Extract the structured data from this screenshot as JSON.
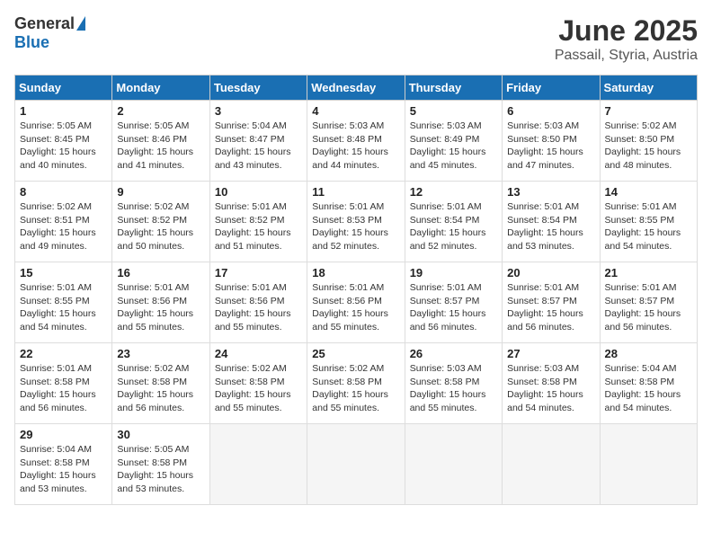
{
  "header": {
    "logo_general": "General",
    "logo_blue": "Blue",
    "title": "June 2025",
    "location": "Passail, Styria, Austria"
  },
  "columns": [
    "Sunday",
    "Monday",
    "Tuesday",
    "Wednesday",
    "Thursday",
    "Friday",
    "Saturday"
  ],
  "weeks": [
    [
      {
        "day": "1",
        "sunrise": "Sunrise: 5:05 AM",
        "sunset": "Sunset: 8:45 PM",
        "daylight": "Daylight: 15 hours and 40 minutes."
      },
      {
        "day": "2",
        "sunrise": "Sunrise: 5:05 AM",
        "sunset": "Sunset: 8:46 PM",
        "daylight": "Daylight: 15 hours and 41 minutes."
      },
      {
        "day": "3",
        "sunrise": "Sunrise: 5:04 AM",
        "sunset": "Sunset: 8:47 PM",
        "daylight": "Daylight: 15 hours and 43 minutes."
      },
      {
        "day": "4",
        "sunrise": "Sunrise: 5:03 AM",
        "sunset": "Sunset: 8:48 PM",
        "daylight": "Daylight: 15 hours and 44 minutes."
      },
      {
        "day": "5",
        "sunrise": "Sunrise: 5:03 AM",
        "sunset": "Sunset: 8:49 PM",
        "daylight": "Daylight: 15 hours and 45 minutes."
      },
      {
        "day": "6",
        "sunrise": "Sunrise: 5:03 AM",
        "sunset": "Sunset: 8:50 PM",
        "daylight": "Daylight: 15 hours and 47 minutes."
      },
      {
        "day": "7",
        "sunrise": "Sunrise: 5:02 AM",
        "sunset": "Sunset: 8:50 PM",
        "daylight": "Daylight: 15 hours and 48 minutes."
      }
    ],
    [
      {
        "day": "8",
        "sunrise": "Sunrise: 5:02 AM",
        "sunset": "Sunset: 8:51 PM",
        "daylight": "Daylight: 15 hours and 49 minutes."
      },
      {
        "day": "9",
        "sunrise": "Sunrise: 5:02 AM",
        "sunset": "Sunset: 8:52 PM",
        "daylight": "Daylight: 15 hours and 50 minutes."
      },
      {
        "day": "10",
        "sunrise": "Sunrise: 5:01 AM",
        "sunset": "Sunset: 8:52 PM",
        "daylight": "Daylight: 15 hours and 51 minutes."
      },
      {
        "day": "11",
        "sunrise": "Sunrise: 5:01 AM",
        "sunset": "Sunset: 8:53 PM",
        "daylight": "Daylight: 15 hours and 52 minutes."
      },
      {
        "day": "12",
        "sunrise": "Sunrise: 5:01 AM",
        "sunset": "Sunset: 8:54 PM",
        "daylight": "Daylight: 15 hours and 52 minutes."
      },
      {
        "day": "13",
        "sunrise": "Sunrise: 5:01 AM",
        "sunset": "Sunset: 8:54 PM",
        "daylight": "Daylight: 15 hours and 53 minutes."
      },
      {
        "day": "14",
        "sunrise": "Sunrise: 5:01 AM",
        "sunset": "Sunset: 8:55 PM",
        "daylight": "Daylight: 15 hours and 54 minutes."
      }
    ],
    [
      {
        "day": "15",
        "sunrise": "Sunrise: 5:01 AM",
        "sunset": "Sunset: 8:55 PM",
        "daylight": "Daylight: 15 hours and 54 minutes."
      },
      {
        "day": "16",
        "sunrise": "Sunrise: 5:01 AM",
        "sunset": "Sunset: 8:56 PM",
        "daylight": "Daylight: 15 hours and 55 minutes."
      },
      {
        "day": "17",
        "sunrise": "Sunrise: 5:01 AM",
        "sunset": "Sunset: 8:56 PM",
        "daylight": "Daylight: 15 hours and 55 minutes."
      },
      {
        "day": "18",
        "sunrise": "Sunrise: 5:01 AM",
        "sunset": "Sunset: 8:56 PM",
        "daylight": "Daylight: 15 hours and 55 minutes."
      },
      {
        "day": "19",
        "sunrise": "Sunrise: 5:01 AM",
        "sunset": "Sunset: 8:57 PM",
        "daylight": "Daylight: 15 hours and 56 minutes."
      },
      {
        "day": "20",
        "sunrise": "Sunrise: 5:01 AM",
        "sunset": "Sunset: 8:57 PM",
        "daylight": "Daylight: 15 hours and 56 minutes."
      },
      {
        "day": "21",
        "sunrise": "Sunrise: 5:01 AM",
        "sunset": "Sunset: 8:57 PM",
        "daylight": "Daylight: 15 hours and 56 minutes."
      }
    ],
    [
      {
        "day": "22",
        "sunrise": "Sunrise: 5:01 AM",
        "sunset": "Sunset: 8:58 PM",
        "daylight": "Daylight: 15 hours and 56 minutes."
      },
      {
        "day": "23",
        "sunrise": "Sunrise: 5:02 AM",
        "sunset": "Sunset: 8:58 PM",
        "daylight": "Daylight: 15 hours and 56 minutes."
      },
      {
        "day": "24",
        "sunrise": "Sunrise: 5:02 AM",
        "sunset": "Sunset: 8:58 PM",
        "daylight": "Daylight: 15 hours and 55 minutes."
      },
      {
        "day": "25",
        "sunrise": "Sunrise: 5:02 AM",
        "sunset": "Sunset: 8:58 PM",
        "daylight": "Daylight: 15 hours and 55 minutes."
      },
      {
        "day": "26",
        "sunrise": "Sunrise: 5:03 AM",
        "sunset": "Sunset: 8:58 PM",
        "daylight": "Daylight: 15 hours and 55 minutes."
      },
      {
        "day": "27",
        "sunrise": "Sunrise: 5:03 AM",
        "sunset": "Sunset: 8:58 PM",
        "daylight": "Daylight: 15 hours and 54 minutes."
      },
      {
        "day": "28",
        "sunrise": "Sunrise: 5:04 AM",
        "sunset": "Sunset: 8:58 PM",
        "daylight": "Daylight: 15 hours and 54 minutes."
      }
    ],
    [
      {
        "day": "29",
        "sunrise": "Sunrise: 5:04 AM",
        "sunset": "Sunset: 8:58 PM",
        "daylight": "Daylight: 15 hours and 53 minutes."
      },
      {
        "day": "30",
        "sunrise": "Sunrise: 5:05 AM",
        "sunset": "Sunset: 8:58 PM",
        "daylight": "Daylight: 15 hours and 53 minutes."
      },
      null,
      null,
      null,
      null,
      null
    ]
  ]
}
